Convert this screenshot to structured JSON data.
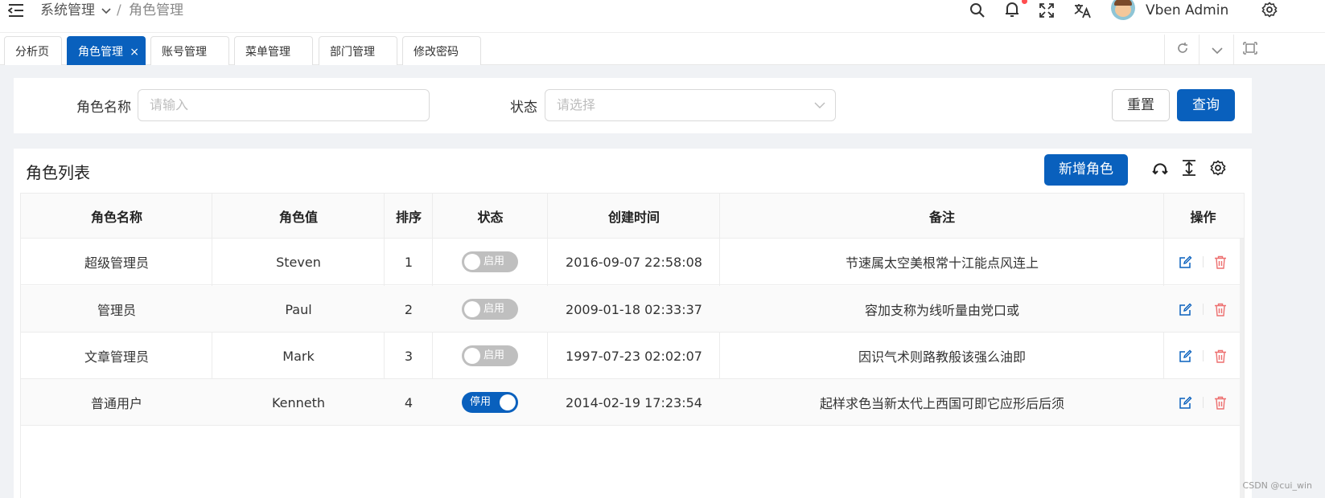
{
  "header": {
    "breadcrumb": [
      "系统管理",
      "角色管理"
    ],
    "breadcrumb_sep": "/",
    "user_name": "Vben Admin",
    "icons": [
      "menu-fold-icon",
      "search-icon",
      "bell-icon",
      "fullscreen-icon",
      "translate-icon",
      "avatar",
      "gear-icon"
    ],
    "notification_dot_color": "#ff4d4f"
  },
  "tabs": [
    {
      "label": "分析页",
      "active": false
    },
    {
      "label": "角色管理",
      "active": true,
      "close": "×"
    },
    {
      "label": "账号管理",
      "active": false
    },
    {
      "label": "菜单管理",
      "active": false
    },
    {
      "label": "部门管理",
      "active": false
    },
    {
      "label": "修改密码",
      "active": false
    }
  ],
  "search_form": {
    "role_name_label": "角色名称",
    "role_name_placeholder": "请输入",
    "status_label": "状态",
    "status_placeholder": "请选择",
    "reset_label": "重置",
    "query_label": "查询"
  },
  "table": {
    "title": "角色列表",
    "add_button_label": "新增角色",
    "columns": [
      "角色名称",
      "角色值",
      "排序",
      "状态",
      "创建时间",
      "备注",
      "操作"
    ],
    "rows": [
      {
        "name": "超级管理员",
        "value": "Steven",
        "order": "1",
        "status": "启用",
        "status_on": false,
        "created": "2016-09-07 22:58:08",
        "remark": "节速属太空美根常十江能点风连上"
      },
      {
        "name": "管理员",
        "value": "Paul",
        "order": "2",
        "status": "启用",
        "status_on": false,
        "created": "2009-01-18 02:33:37",
        "remark": "容加支称为线听量由党口或"
      },
      {
        "name": "文章管理员",
        "value": "Mark",
        "order": "3",
        "status": "启用",
        "status_on": false,
        "created": "1997-07-23 02:02:07",
        "remark": "因识气术则路教般该强么油即"
      },
      {
        "name": "普通用户",
        "value": "Kenneth",
        "order": "4",
        "status": "停用",
        "status_on": true,
        "created": "2014-02-19 17:23:54",
        "remark": "起样求色当新太代上西国可即它应形后后须"
      }
    ]
  },
  "colors": {
    "primary": "#0960bd",
    "danger": "#ed6f6f",
    "switch_off": "#bfbfbf"
  },
  "watermark": "CSDN @cui_win"
}
